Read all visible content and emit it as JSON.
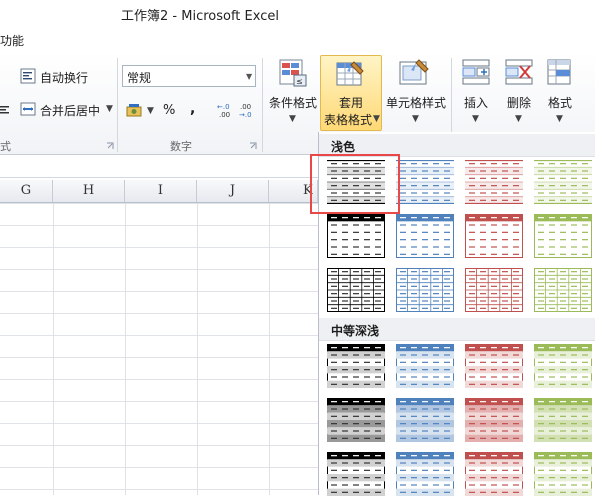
{
  "window": {
    "title": "工作簿2  -  Microsoft Excel"
  },
  "menu": {
    "partial_label": "功能"
  },
  "ribbon": {
    "wrap_text_label": "自动换行",
    "merge_center_label": "合并后居中",
    "number_format_value": "常规",
    "percent_label": "%",
    "comma_label": ",",
    "inc_decimal_label": "←.0 .00",
    "dec_decimal_label": ".00 →.0",
    "group_alignment_partial": "式",
    "group_number_label": "数字",
    "conditional_format_label": "条件格式",
    "table_format_label_1": "套用",
    "table_format_label_2": "表格格式",
    "cell_styles_label": "单元格样式",
    "insert_label": "插入",
    "delete_label": "删除",
    "format_label": "格式"
  },
  "columns": [
    "G",
    "H",
    "I",
    "J",
    "K"
  ],
  "gallery": {
    "light_title": "浅色",
    "medium_title": "中等深浅",
    "accent_colors": [
      "#000000",
      "#4f81bd",
      "#c0504d",
      "#9bbb59"
    ],
    "light_styles": [
      [
        {
          "accent": "#000000",
          "style": "lines"
        },
        {
          "accent": "#4f81bd",
          "style": "lines"
        },
        {
          "accent": "#c0504d",
          "style": "lines"
        },
        {
          "accent": "#9bbb59",
          "style": "lines"
        }
      ],
      [
        {
          "accent": "#000000",
          "style": "banded-header"
        },
        {
          "accent": "#4f81bd",
          "style": "banded-header"
        },
        {
          "accent": "#c0504d",
          "style": "banded-header"
        },
        {
          "accent": "#9bbb59",
          "style": "banded-header"
        }
      ],
      [
        {
          "accent": "#000000",
          "style": "grid"
        },
        {
          "accent": "#4f81bd",
          "style": "grid"
        },
        {
          "accent": "#c0504d",
          "style": "grid"
        },
        {
          "accent": "#9bbb59",
          "style": "grid"
        }
      ]
    ],
    "medium_styles": [
      [
        {
          "accent": "#000000",
          "style": "medium"
        },
        {
          "accent": "#4f81bd",
          "style": "medium"
        },
        {
          "accent": "#c0504d",
          "style": "medium"
        },
        {
          "accent": "#9bbb59",
          "style": "medium"
        }
      ],
      [
        {
          "accent": "#000000",
          "style": "medium-fill"
        },
        {
          "accent": "#4f81bd",
          "style": "medium-fill"
        },
        {
          "accent": "#c0504d",
          "style": "medium-fill"
        },
        {
          "accent": "#9bbb59",
          "style": "medium-fill"
        }
      ],
      [
        {
          "accent": "#000000",
          "style": "medium"
        },
        {
          "accent": "#4f81bd",
          "style": "medium"
        },
        {
          "accent": "#c0504d",
          "style": "medium"
        },
        {
          "accent": "#9bbb59",
          "style": "medium"
        }
      ]
    ]
  }
}
